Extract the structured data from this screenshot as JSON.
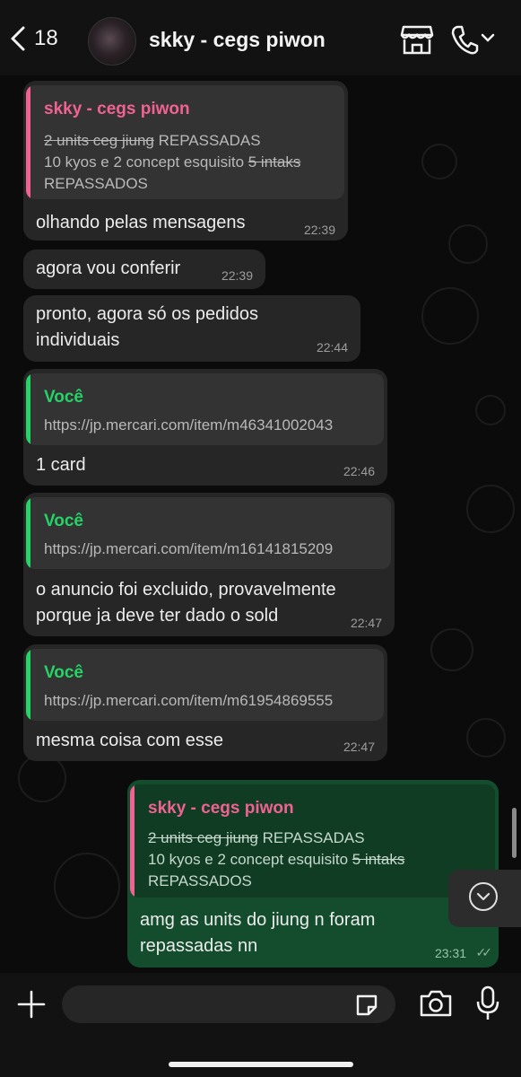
{
  "header": {
    "unread_count": "18",
    "contact_name": "skky - cegs piwon"
  },
  "messages": [
    {
      "direction": "in",
      "quote": {
        "author": "skky - cegs piwon",
        "author_color": "#f06292",
        "line1_strike": "2 units ceg jiung",
        "line1_rest": " REPASSADAS",
        "line2_text": "10 kyos e 2 concept esquisito ",
        "line2_strike": "5 intaks",
        "line3": "REPASSADOS"
      },
      "text": "olhando pelas mensagens",
      "time": "22:39"
    },
    {
      "direction": "in",
      "text": "agora vou conferir",
      "time": "22:39"
    },
    {
      "direction": "in",
      "text_line1": "pronto, agora só os pedidos",
      "text_line2": "individuais",
      "time": "22:44"
    },
    {
      "direction": "in",
      "quote": {
        "author": "Você",
        "author_color": "#25d366",
        "line1": "https://jp.mercari.com/item/m46341002043"
      },
      "text": "1 card",
      "time": "22:46"
    },
    {
      "direction": "in",
      "quote": {
        "author": "Você",
        "author_color": "#25d366",
        "line1": "https://jp.mercari.com/item/m16141815209"
      },
      "text_line1": "o anuncio foi excluido, provavelmente",
      "text_line2": "porque ja deve ter dado o sold",
      "time": "22:47"
    },
    {
      "direction": "in",
      "quote": {
        "author": "Você",
        "author_color": "#25d366",
        "line1": "https://jp.mercari.com/item/m61954869555"
      },
      "text": "mesma coisa com esse",
      "time": "22:47"
    },
    {
      "direction": "out",
      "quote": {
        "author": "skky - cegs piwon",
        "author_color": "#f06292",
        "line1_strike": "2 units ceg jiung",
        "line1_rest": " REPASSADAS",
        "line2_text": "10 kyos e 2 concept esquisito ",
        "line2_strike": "5 intaks",
        "line3": "REPASSADOS"
      },
      "text_line1": "amg as units do jiung n foram",
      "text_line2": "repassadas nn",
      "time": "23:31",
      "status": "read"
    }
  ],
  "colors": {
    "background": "#0b0b0b",
    "incoming_bubble": "#262626",
    "outgoing_bubble": "#144d2e",
    "accent_green": "#25d366",
    "accent_pink": "#f06292"
  },
  "icons": {
    "back": "chevron-left-icon",
    "catalog": "store-icon",
    "call": "phone-icon",
    "call_menu": "chevron-down-icon",
    "scroll_down": "chevron-down-circle-icon",
    "attach": "plus-icon",
    "sticker": "sticker-icon",
    "camera": "camera-icon",
    "mic": "microphone-icon"
  }
}
